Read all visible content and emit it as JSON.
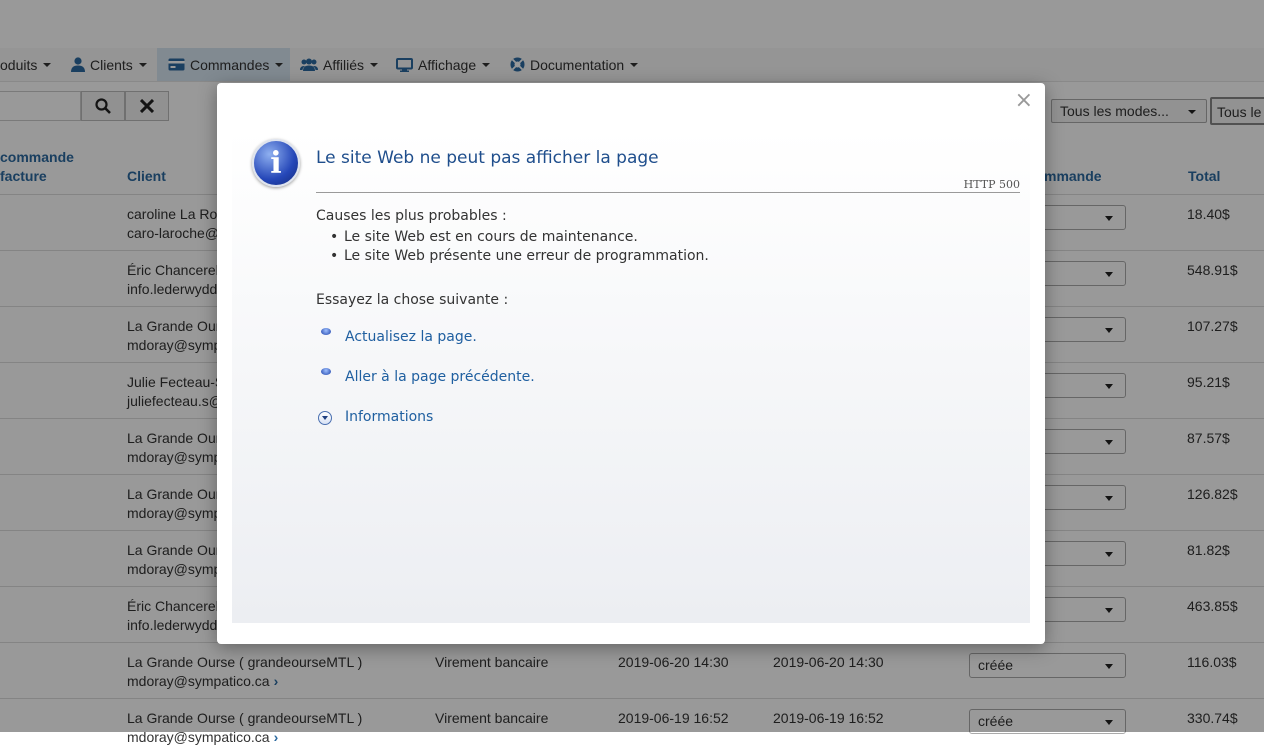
{
  "nav": {
    "items": [
      {
        "label": "oduits"
      },
      {
        "label": "Clients"
      },
      {
        "label": "Commandes"
      },
      {
        "label": "Affiliés"
      },
      {
        "label": "Affichage"
      },
      {
        "label": "Documentation"
      }
    ]
  },
  "filters": {
    "mode_select": "Tous les modes...",
    "second_select": "Tous le"
  },
  "table": {
    "headers": {
      "order_line1": "commande",
      "order_line2": "facture",
      "client": "Client",
      "status": "mmande",
      "total": "Total"
    },
    "rows": [
      {
        "client": "caroline La Roc",
        "email": "caro-laroche@",
        "total": "18.40$"
      },
      {
        "client": "Éric Chancerel",
        "email": "info.lederwydd",
        "total": "548.91$"
      },
      {
        "client": "La Grande Our",
        "email": "mdoray@symp",
        "total": "107.27$"
      },
      {
        "client": "Julie Fecteau-S",
        "email": "juliefecteau.s@",
        "total": "95.21$"
      },
      {
        "client": "La Grande Our",
        "email": "mdoray@symp",
        "total": "87.57$"
      },
      {
        "client": "La Grande Our",
        "email": "mdoray@symp",
        "total": "126.82$"
      },
      {
        "client": "La Grande Our",
        "email": "mdoray@symp",
        "total": "81.82$"
      },
      {
        "client": "Éric Chancerel",
        "email": "info.lederwydd",
        "total": "463.85$"
      },
      {
        "client": "La Grande Ourse ( grandeourseMTL )",
        "email": "mdoray@sympatico.ca",
        "payment": "Virement bancaire",
        "date1": "2019-06-20 14:30",
        "date2": "2019-06-20 14:30",
        "status": "créée",
        "total": "116.03$"
      },
      {
        "client": "La Grande Ourse ( grandeourseMTL )",
        "email": "mdoray@sympatico.ca",
        "payment": "Virement bancaire",
        "date1": "2019-06-19 16:52",
        "date2": "2019-06-19 16:52",
        "status": "créée",
        "total": "330.74$"
      }
    ]
  },
  "dialog": {
    "close": "×",
    "title": "Le site Web ne peut pas afficher la page",
    "code": "HTTP 500",
    "causes_heading": "Causes les plus probables :",
    "causes": [
      "Le site Web est en cours de maintenance.",
      "Le site Web présente une erreur de programmation."
    ],
    "try_heading": "Essayez la chose suivante :",
    "links": [
      "Actualisez la page.",
      "Aller à la page précédente."
    ],
    "more": "Informations"
  }
}
